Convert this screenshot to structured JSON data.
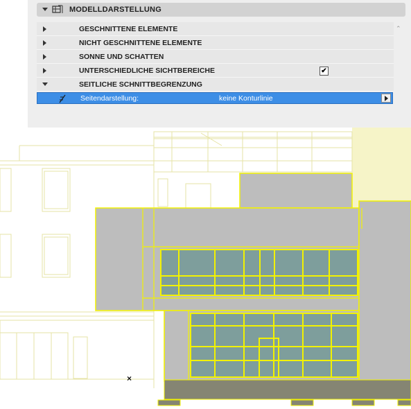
{
  "panel": {
    "header": {
      "title": "MODELLDARSTELLUNG",
      "icon": "model-display-icon"
    },
    "rows": [
      {
        "label": "GESCHNITTENE ELEMENTE",
        "expanded": false
      },
      {
        "label": "NICHT GESCHNITTENE ELEMENTE",
        "expanded": false
      },
      {
        "label": "SONNE UND SCHATTEN",
        "expanded": false
      },
      {
        "label": "UNTERSCHIEDLICHE SICHTBEREICHE",
        "expanded": false,
        "checked": true,
        "check_glyph": "✔"
      },
      {
        "label": "SEITLICHE SCHNITTBEGRENZUNG",
        "expanded": true
      }
    ],
    "selected_property": {
      "label": "Seitendarstellung:",
      "value": "keine Konturlinie"
    },
    "scroll_up_glyph": "⌃"
  },
  "drawing": {
    "marker_glyph": "×"
  },
  "colors": {
    "panel_bg": "#eeeeee",
    "header_bg": "#d2d2d2",
    "row_bg": "#e7e7e7",
    "selection": "#3d8ee6",
    "highlight_line": "#f2f200",
    "faint_line": "#e8e6a8",
    "wall_gray": "#bdbdbd",
    "glass": "#7e9e9c",
    "base_dark": "#858573"
  }
}
